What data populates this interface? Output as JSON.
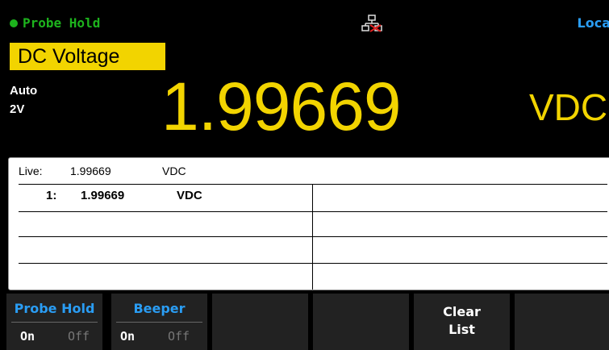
{
  "status": {
    "hold_indicator": "Probe Hold",
    "remote_state": "Loca"
  },
  "measurement": {
    "function": "DC Voltage",
    "range_mode": "Auto",
    "range_value": "2V",
    "reading": "1.99669",
    "unit": "VDC"
  },
  "list": {
    "live_label": "Live:",
    "live_value": "1.99669",
    "live_unit": "VDC",
    "entries": [
      {
        "index": "1:",
        "value": "1.99669",
        "unit": "VDC"
      }
    ]
  },
  "softkeys": {
    "probe_hold": {
      "title": "Probe Hold",
      "on": "On",
      "off": "Off"
    },
    "beeper": {
      "title": "Beeper",
      "on": "On",
      "off": "Off"
    },
    "clear_list": {
      "line1": "Clear",
      "line2": "List"
    }
  },
  "colors": {
    "accent": "#f2d400",
    "status_green": "#1db31d",
    "label_blue": "#2a9df4"
  }
}
